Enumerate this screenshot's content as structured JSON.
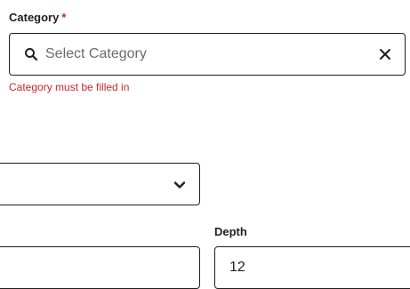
{
  "category": {
    "label": "Category",
    "required_mark": "*",
    "placeholder": "Select Category",
    "value": "",
    "error": "Category must be filled in",
    "search_icon": "search-icon",
    "clear_icon": "close-icon"
  },
  "dropdown": {
    "selected": "",
    "icon": "chevron-down-icon"
  },
  "depth": {
    "label": "Depth",
    "value": "12"
  },
  "colors": {
    "error": "#c62828",
    "border": "#1f1f1f",
    "placeholder": "#6b6b6b"
  }
}
